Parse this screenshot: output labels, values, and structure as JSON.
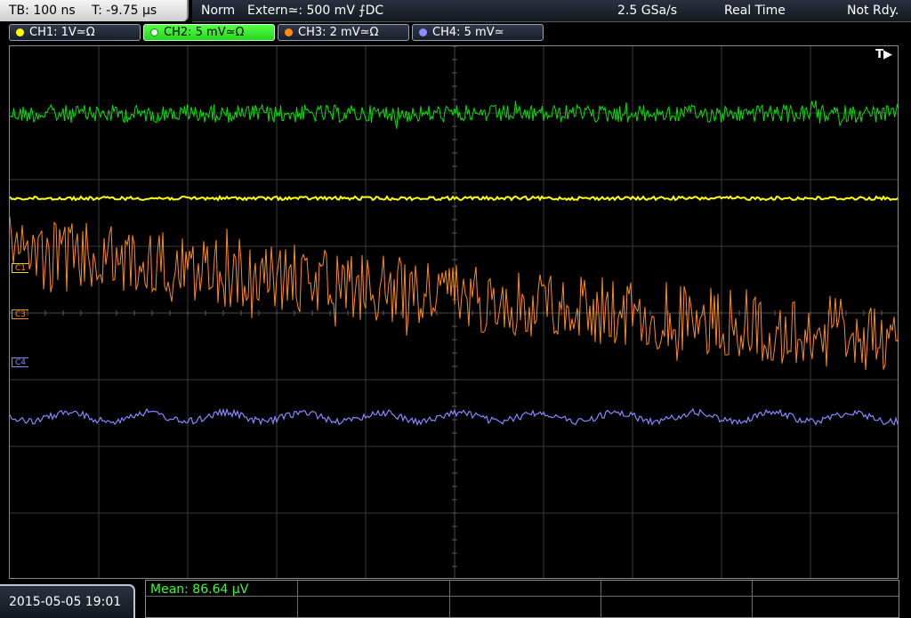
{
  "topbar": {
    "timebase": "TB: 100 ns",
    "trigger_time": "T: -9.75 µs",
    "trigger_mode": "Norm",
    "trigger_source": "Extern≃: 500 mV ⨍DC",
    "sample_rate": "2.5 GSa/s",
    "acq_mode": "Real Time",
    "status": "Not Rdy."
  },
  "channels": [
    {
      "label": "CH1: 1V≃Ω",
      "color": "#ffff00",
      "active": false
    },
    {
      "label": "CH2: 5 mV≃Ω",
      "color": "#00ff00",
      "active": true
    },
    {
      "label": "CH3: 2 mV≃Ω",
      "color": "#ff8c1a",
      "active": false
    },
    {
      "label": "CH4: 5 mV≃",
      "color": "#8a8cff",
      "active": false
    }
  ],
  "markers": {
    "c1": "C1",
    "c3": "C3",
    "c4": "C4",
    "trigger": "T▶"
  },
  "trace_colors": {
    "ch1": "#ffff00",
    "ch2": "#00e400",
    "ch3": "#ff8a20",
    "ch4": "#8888ff"
  },
  "bottom": {
    "date": "2015-05-05 19:01",
    "mean": "Mean: 86.64 µV"
  }
}
